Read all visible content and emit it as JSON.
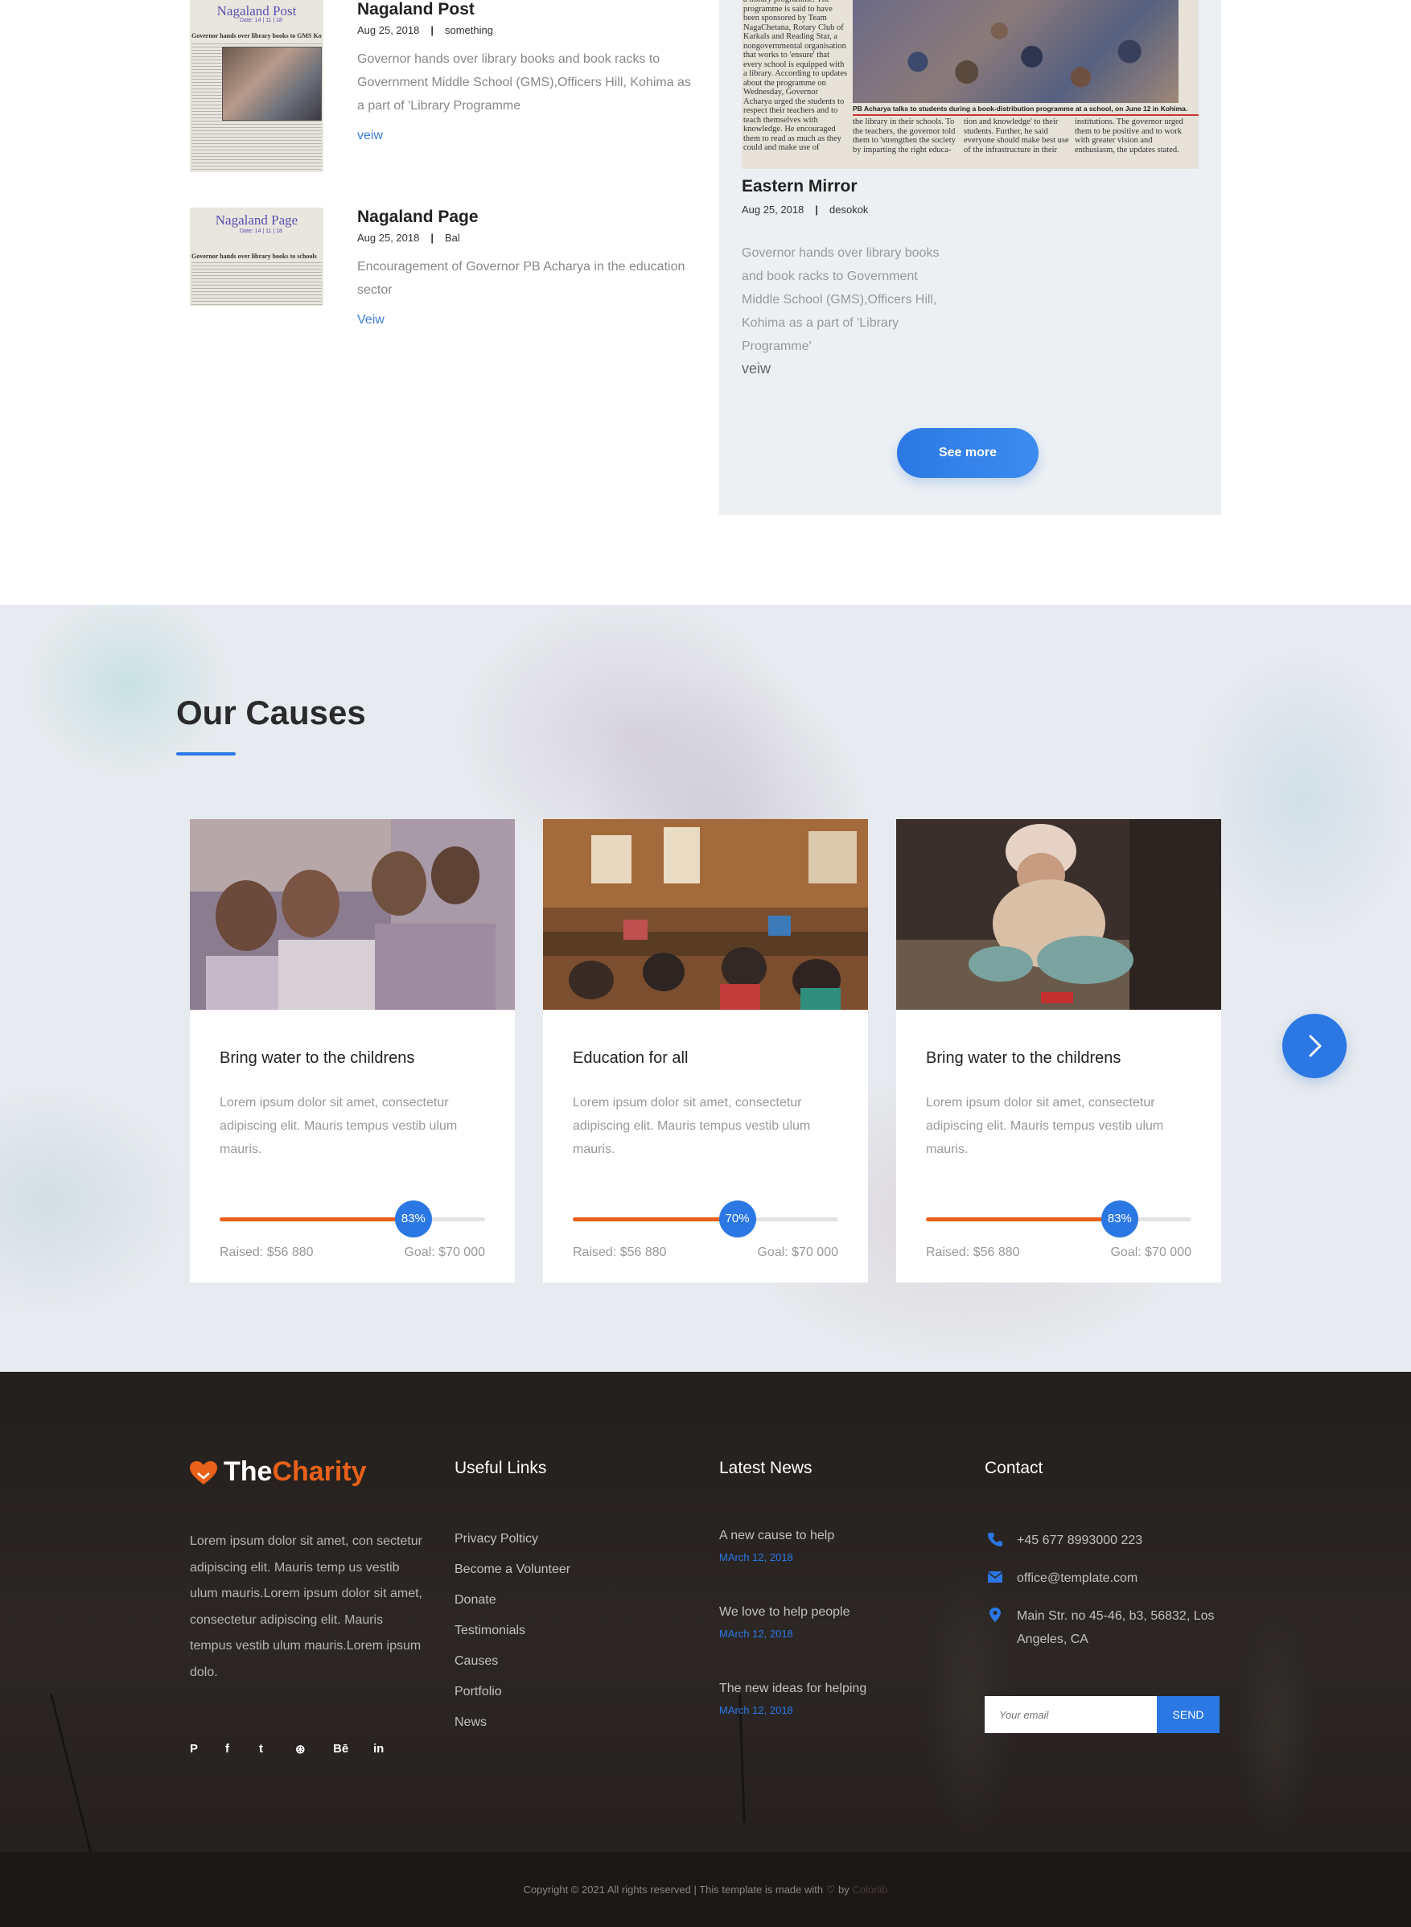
{
  "news": {
    "items": [
      {
        "title": "Nagaland Post",
        "date": "Aug 25, 2018",
        "separator": "|",
        "author": "something",
        "description": "Governor hands over library books and book racks to Government Middle School (GMS),Officers Hill, Kohima as a part of 'Library Programme",
        "link": "veiw",
        "thumb": {
          "masthead": "Nagaland Post",
          "dateline": "Date: 14 | 11 | 18",
          "headline": "Governor hands over library books to GMS Kohima"
        }
      },
      {
        "title": "Nagaland Page",
        "date": "Aug 25, 2018",
        "separator": "|",
        "author": "Bal",
        "description": "Encouragement of Governor PB Acharya in the education sector",
        "link": "Veiw",
        "thumb": {
          "masthead": "Nagaland Page",
          "dateline": "Date: 14 | 11 | 18",
          "headline": "Governor hands over library books to schools"
        }
      }
    ],
    "featured": {
      "title": "Eastern Mirror",
      "date": "Aug 25, 2018",
      "separator": "|",
      "author": "desokok",
      "description": "Governor hands over library books and book racks to Government Middle School (GMS),Officers Hill, Kohima as a part of 'Library Programme'",
      "link": "veiw",
      "see_more": "See more",
      "clipping": {
        "col1": "a library programme. The programme is said to have been sponsored by Team NagaChetana, Rotary Club of Karkals and Reading Star, a nongovernmental organisation that works to 'ensure' that every school is equipped with a library. According to updates about the programme on Wednesday, Governor Acharya urged the students to respect their teachers and to teach themselves with knowledge. He encouraged them to read as much as they could and make use of",
        "caption": "PB Acharya talks to students during a book-distribution programme at a school, on June 12 in Kohima.",
        "col2": "the library in their schools. To the teachers, the governor told them to 'strengthen the society by imparting the right educa-",
        "col3": "tion and knowledge' to their students. Further, he said everyone should make best use of the infrastructure in their",
        "col4": "institutions. The governor urged them to be positive and to work with greater vision and enthusiasm, the updates stated."
      }
    }
  },
  "causes": {
    "title": "Our Causes",
    "cards": [
      {
        "title": "Bring water to the childrens",
        "description": "Lorem ipsum dolor sit amet, consectetur adipiscing elit. Mauris tempus vestib ulum mauris.",
        "percent_label": "83%",
        "progress": 0.73,
        "raised": "Raised: $56 880",
        "goal": "Goal: $70 000"
      },
      {
        "title": "Education for all",
        "description": "Lorem ipsum dolor sit amet, consectetur adipiscing elit. Mauris tempus vestib ulum mauris.",
        "percent_label": "70%",
        "progress": 0.62,
        "raised": "Raised: $56 880",
        "goal": "Goal: $70 000"
      },
      {
        "title": "Bring water to the childrens",
        "description": "Lorem ipsum dolor sit amet, consectetur adipiscing elit. Mauris tempus vestib ulum mauris.",
        "percent_label": "83%",
        "progress": 0.73,
        "raised": "Raised: $56 880",
        "goal": "Goal: $70 000"
      }
    ],
    "next_icon": "chevron-right-icon"
  },
  "footer": {
    "logo": {
      "the": "The",
      "charity": "Charity",
      "icon": "heart-hands-icon"
    },
    "about": "Lorem ipsum dolor sit amet, con sectetur adipiscing elit. Mauris temp us vestib ulum mauris.Lorem ipsum dolor sit amet, consectetur adipiscing elit. Mauris tempus vestib ulum mauris.Lorem ipsum dolo.",
    "social": [
      {
        "name": "pinterest-icon",
        "glyph": "P"
      },
      {
        "name": "facebook-icon",
        "glyph": "f"
      },
      {
        "name": "twitter-icon",
        "glyph": "t"
      },
      {
        "name": "dribbble-icon",
        "glyph": "⊛"
      },
      {
        "name": "behance-icon",
        "glyph": "Bē"
      },
      {
        "name": "linkedin-icon",
        "glyph": "in"
      }
    ],
    "useful_links_title": "Useful Links",
    "useful_links": [
      "Privacy Polticy",
      "Become a Volunteer",
      "Donate",
      "Testimonials",
      "Causes",
      "Portfolio",
      "News"
    ],
    "latest_news_title": "Latest News",
    "latest_news": [
      {
        "title": "A new cause to help",
        "date": "MArch 12, 2018"
      },
      {
        "title": "We love to help people",
        "date": "MArch 12, 2018"
      },
      {
        "title": "The new ideas for helping",
        "date": "MArch 12, 2018"
      }
    ],
    "contact_title": "Contact",
    "contact": {
      "phone": "+45 677 8993000 223",
      "email": "office@template.com",
      "address": "Main Str. no 45-46, b3, 56832, Los Angeles, CA"
    },
    "subscribe": {
      "placeholder": "Your email",
      "button": "SEND"
    },
    "copyright": "Copyright © 2021 All rights reserved | This template is made with ♡ by",
    "copyright_by": "Colorlib"
  },
  "colors": {
    "accent": "#2b78e4",
    "brand_orange": "#e8611a",
    "footer_bg": "#2a2522"
  }
}
